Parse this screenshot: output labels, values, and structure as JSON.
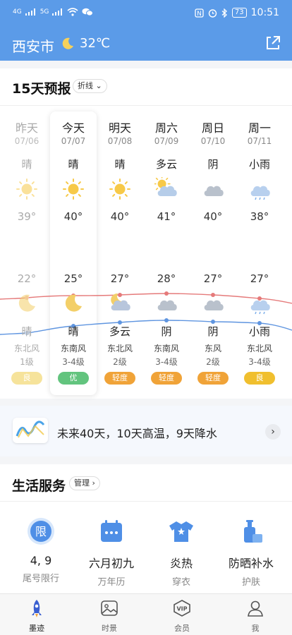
{
  "status_bar": {
    "time": "10:51",
    "battery": "73",
    "network_left": "4G",
    "network_right": "5G"
  },
  "header": {
    "city": "西安市",
    "temperature": "32℃",
    "weather_icon": "moon-icon",
    "share_icon": "share-icon"
  },
  "forecast": {
    "title": "15天预报",
    "mode": "折线",
    "days": [
      {
        "name": "昨天",
        "date": "07/06",
        "day_desc": "晴",
        "day_icon": "sun-icon",
        "high": "39°",
        "low": "22°",
        "night_icon": "moon-icon",
        "night_desc": "晴",
        "wind": "东北风",
        "wind_level": "1级",
        "aqi": "良",
        "aqi_color": "#f6e39b",
        "past": true
      },
      {
        "name": "今天",
        "date": "07/07",
        "day_desc": "晴",
        "day_icon": "sun-icon",
        "high": "40°",
        "low": "25°",
        "night_icon": "moon-icon",
        "night_desc": "晴",
        "wind": "东南风",
        "wind_level": "3-4级",
        "aqi": "优",
        "aqi_color": "#62c47e",
        "past": false
      },
      {
        "name": "明天",
        "date": "07/08",
        "day_desc": "晴",
        "day_icon": "sun-icon",
        "high": "40°",
        "low": "27°",
        "night_icon": "moon-cloud-icon",
        "night_desc": "多云",
        "wind": "东北风",
        "wind_level": "2级",
        "aqi": "轻度",
        "aqi_color": "#f0a338",
        "past": false
      },
      {
        "name": "周六",
        "date": "07/09",
        "day_desc": "多云",
        "day_icon": "sun-cloud-icon",
        "high": "41°",
        "low": "28°",
        "night_icon": "cloud-icon",
        "night_desc": "阴",
        "wind": "东南风",
        "wind_level": "3-4级",
        "aqi": "轻度",
        "aqi_color": "#f0a338",
        "past": false
      },
      {
        "name": "周日",
        "date": "07/10",
        "day_desc": "阴",
        "day_icon": "cloud-icon",
        "high": "40°",
        "low": "27°",
        "night_icon": "cloud-icon",
        "night_desc": "阴",
        "wind": "东风",
        "wind_level": "2级",
        "aqi": "轻度",
        "aqi_color": "#f0a338",
        "past": false
      },
      {
        "name": "周一",
        "date": "07/11",
        "day_desc": "小雨",
        "day_icon": "rain-cloud-icon",
        "high": "38°",
        "low": "27°",
        "night_icon": "rain-cloud-icon",
        "night_desc": "小雨",
        "wind": "东北风",
        "wind_level": "3-4级",
        "aqi": "良",
        "aqi_color": "#f0bf2e",
        "past": false
      }
    ]
  },
  "banner": {
    "text": "未来40天，10天高温，9天降水"
  },
  "services": {
    "title": "生活服务",
    "manage": "管理",
    "items": [
      {
        "value": "4, 9",
        "label": "尾号限行",
        "icon": "limit-icon"
      },
      {
        "value": "六月初九",
        "label": "万年历",
        "icon": "calendar-icon"
      },
      {
        "value": "炎热",
        "label": "穿衣",
        "icon": "shirt-icon"
      },
      {
        "value": "防晒补水",
        "label": "护肤",
        "icon": "skincare-icon"
      }
    ]
  },
  "tabbar": {
    "items": [
      {
        "label": "墨迹",
        "icon": "rocket-icon",
        "active": true
      },
      {
        "label": "时景",
        "icon": "image-icon",
        "active": false
      },
      {
        "label": "会员",
        "icon": "vip-icon",
        "active": false
      },
      {
        "label": "我",
        "icon": "user-icon",
        "active": false
      }
    ]
  },
  "colors": {
    "header_bg": "#5b9be8",
    "high_line": "#e57a7a",
    "low_line": "#5f95e0"
  }
}
